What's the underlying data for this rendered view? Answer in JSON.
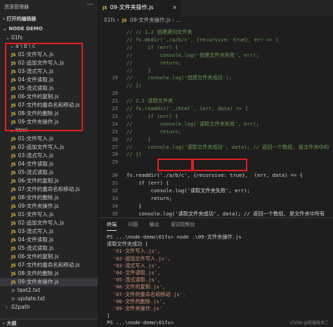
{
  "sidebar": {
    "title": "资源管理器",
    "open_editors": "打开的编辑器",
    "project": "NODE DEMO",
    "folder_01fs": "01fs",
    "folder_abc": "a \\ b \\ c",
    "folder_html": "html",
    "abc_files": [
      "01-文件写入.js",
      "02-追加文件写入.js",
      "03-流式写入.js",
      "04-文件读取.js",
      "05-流式读取.js",
      "06-文件的复制.js",
      "07-文件的重命名和移动.js",
      "08-文件的删除.js",
      "09-文件夹操作.js"
    ],
    "html_files": [
      "01-文件写入.js",
      "02-追加文件写入.js",
      "03-流式写入.js",
      "04-文件读取.js",
      "05-流式读取.js",
      "06-文件的复制.js",
      "07-文件的重命名和移动.js",
      "08-文件的删除.js",
      "09-文件夹操作.js"
    ],
    "fs_files": [
      "01-文件写入.js",
      "02-追加文件写入.js",
      "03-流式写入.js",
      "04-文件读取.js",
      "05-流式读取.js",
      "06-文件的复制.js",
      "07-文件的重命名和移动.js",
      "08-文件的删除.js",
      "09-文件夹操作.js"
    ],
    "txt_files": [
      "text2.txt",
      "update.txt"
    ],
    "next_folder": "02path",
    "outline": "大纲"
  },
  "editor": {
    "tab_label": "09-文件夹操作.js",
    "breadcrumb": [
      "01fs",
      "09-文件夹操作.js",
      "..."
    ],
    "lines": [
      {
        "n": "",
        "t": "// // 1.2 创建递归文件夹",
        "live": false
      },
      {
        "n": "",
        "t": "// fs.mkdir('./a/b/c', {recursive: true}, err => {",
        "live": false
      },
      {
        "n": "",
        "t": "//     if (err) {",
        "live": false
      },
      {
        "n": "",
        "t": "//         console.log('创建文件夹失败', err);",
        "live": false
      },
      {
        "n": "",
        "t": "//         return;",
        "live": false
      },
      {
        "n": "",
        "t": "//     }",
        "live": false
      },
      {
        "n": "19",
        "t": "//     console.log('创建文件夹成功');",
        "live": false
      },
      {
        "n": "",
        "t": "// })",
        "live": false
      },
      {
        "n": "20",
        "t": "",
        "live": false
      },
      {
        "n": "21",
        "t": "// 2.1 读取文件夹",
        "live": false
      },
      {
        "n": "22",
        "t": "// fs.readdir('./html', (err, data) => {",
        "live": false
      },
      {
        "n": "23",
        "t": "//     if (err) {",
        "live": false
      },
      {
        "n": "24",
        "t": "//         console.log('读取文件夹失败', err);",
        "live": false
      },
      {
        "n": "25",
        "t": "//         return;",
        "live": false
      },
      {
        "n": "26",
        "t": "//     }",
        "live": false
      },
      {
        "n": "27",
        "t": "//     console.log('读取文件夹成功', data); // 返回一个数组, 是文件夹中的",
        "live": false
      },
      {
        "n": "28",
        "t": "// })",
        "live": false
      },
      {
        "n": "29",
        "t": "",
        "live": false
      },
      {
        "n": "30",
        "t": "fs.readdir('./a/b/c', {recursive: true},  (err, data) => {",
        "live": true
      },
      {
        "n": "31",
        "t": "    if (err) {",
        "live": true
      },
      {
        "n": "32",
        "t": "        console.log('读取文件夹失败', err);",
        "live": true
      },
      {
        "n": "33",
        "t": "        return;",
        "live": true
      },
      {
        "n": "34",
        "t": "    }",
        "live": true
      },
      {
        "n": "35",
        "t": "    console.log('读取文件夹成功', data); // 返回一个数组, 是文件夹中所有",
        "live": true
      },
      {
        "n": "36",
        "t": "})",
        "live": true
      }
    ]
  },
  "panel": {
    "tabs": [
      "终端",
      "问题",
      "输出",
      "调试控制台"
    ],
    "prompt": "PS ...\\node-demo\\01fs> node .\\09-文件夹操作.js",
    "output_head": "读取文件夹成功 [",
    "output_items": [
      "'01-文件写入.js',",
      "'02-追加文件写入.js',",
      "'03-流式写入.js',",
      "'04-文件读取.js',",
      "'05-流式读取.js',",
      "'06-文件的复制.js',",
      "'07-文件的重命名和移动.js',",
      "'08-文件的删除.js',",
      "'09-文件夹操作.js'"
    ],
    "output_tail": "]",
    "prompt2": "PS ...\\node-demo\\01fs>",
    "watermark": "CSDN @前端技术二"
  }
}
